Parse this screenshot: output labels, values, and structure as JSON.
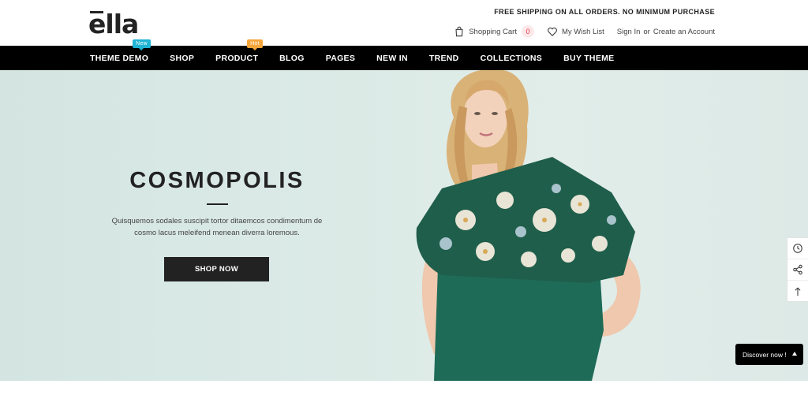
{
  "brand": {
    "logo_text": "ella"
  },
  "header": {
    "shipping_note": "FREE SHIPPING ON ALL ORDERS. NO MINIMUM PURCHASE",
    "cart_label": "Shopping Cart",
    "cart_count": "0",
    "wishlist_label": "My Wish List",
    "signin_label": "Sign In",
    "or_label": "or",
    "create_account_label": "Create an Account"
  },
  "nav": {
    "items": [
      {
        "label": "THEME DEMO",
        "badge": "New"
      },
      {
        "label": "SHOP"
      },
      {
        "label": "PRODUCT",
        "badge": "Hot"
      },
      {
        "label": "BLOG"
      },
      {
        "label": "PAGES"
      },
      {
        "label": "NEW IN"
      },
      {
        "label": "TREND"
      },
      {
        "label": "COLLECTIONS"
      },
      {
        "label": "BUY THEME"
      }
    ]
  },
  "hero": {
    "title": "COSMOPOLIS",
    "description_line1": "Quisquemos sodales suscipit tortor ditaemcos condimentum de",
    "description_line2": "cosmo lacus meleifend menean diverra loremous.",
    "button_label": "SHOP NOW"
  },
  "discover": {
    "label": "Discover now !"
  },
  "colors": {
    "nav_bg": "#000000",
    "hero_bg": "#d9e8e4",
    "badge_new": "#1fb3d4",
    "badge_hot": "#f6a63b",
    "top_green": "#1e6b57"
  },
  "icons": {
    "cart": "shopping-bag-icon",
    "wishlist": "heart-icon",
    "recent": "history-icon",
    "share": "share-icon",
    "top": "arrow-up-icon"
  }
}
